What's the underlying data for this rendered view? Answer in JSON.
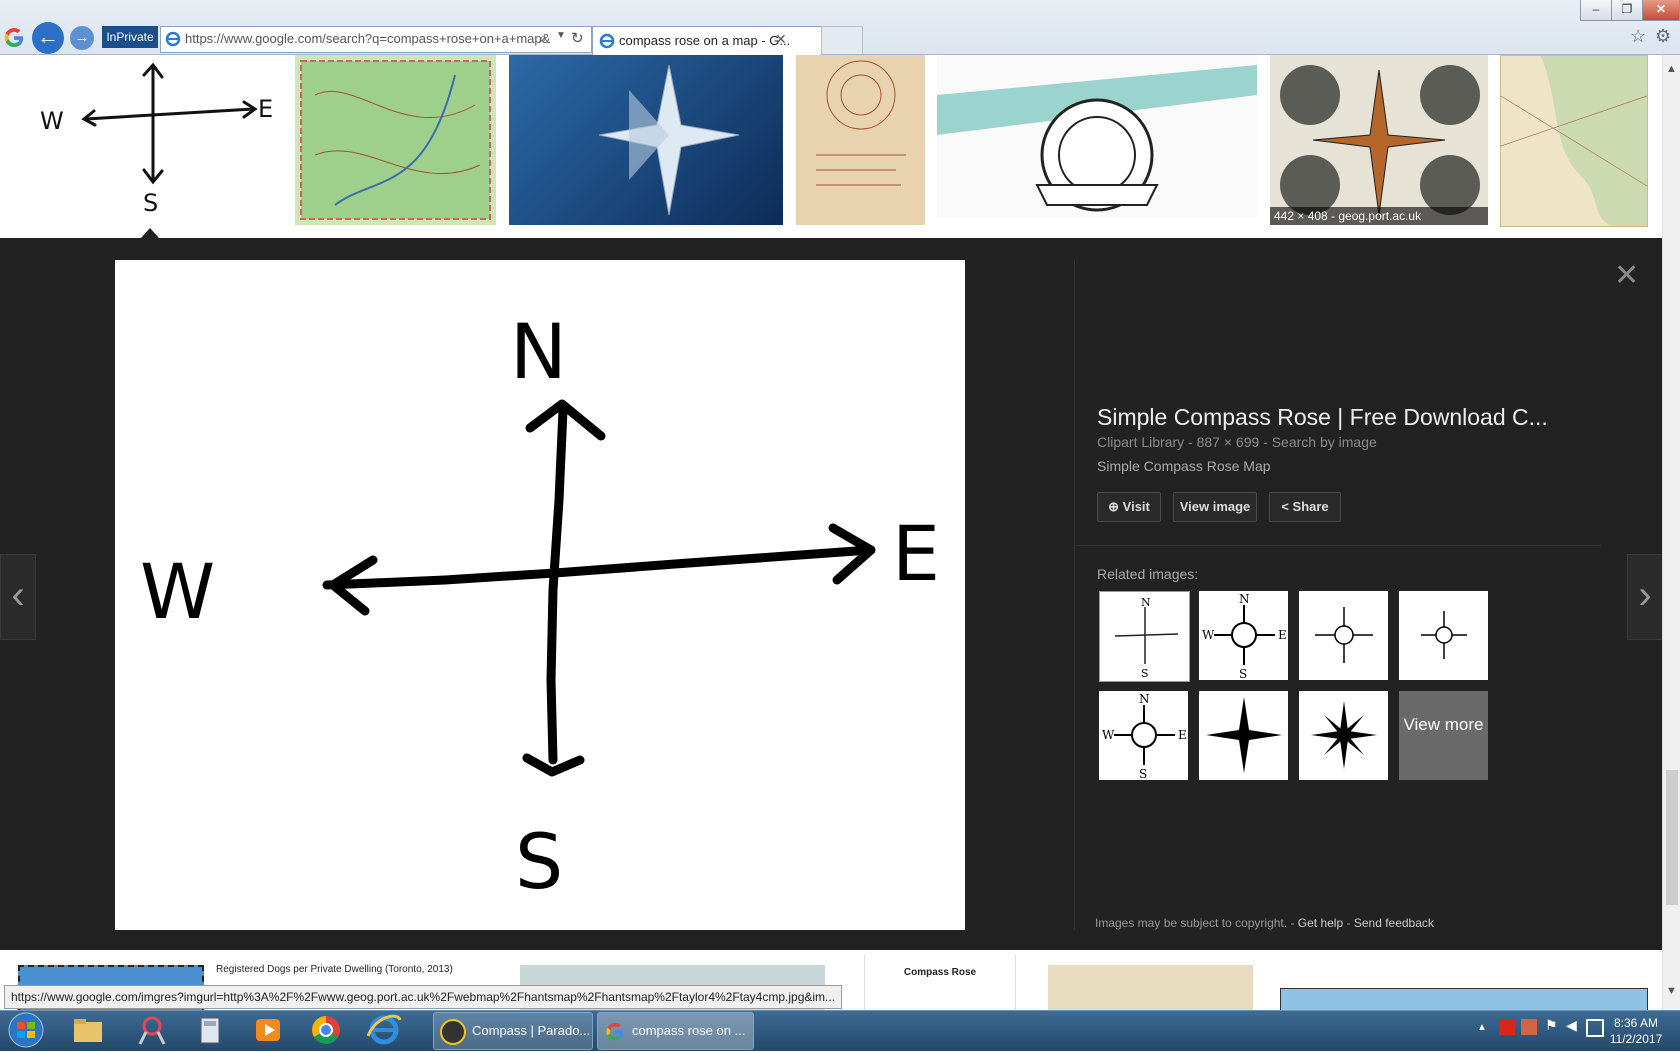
{
  "browser": {
    "mode_badge": "InPrivate",
    "address": "https://www.google.com/search?q=compass+rose+on+a+map&",
    "active_tab": "compass rose on a map - G...",
    "window_buttons": {
      "minimize": "–",
      "maximize": "❐",
      "close": "✕"
    }
  },
  "top_strip": {
    "thumb_caption": "442 × 408 - geog.port.ac.uk",
    "compass_letters": {
      "w": "W",
      "e": "E",
      "s": "S"
    }
  },
  "viewer": {
    "main_image_letters": {
      "n": "N",
      "w": "W",
      "e": "E",
      "s": "S"
    },
    "title": "Simple Compass Rose | Free Download C...",
    "meta": {
      "source": "Clipart Library",
      "sep1": "-",
      "dims": "887 × 699",
      "sep2": "-",
      "search": "Search by image"
    },
    "subtitle": "Simple Compass Rose Map",
    "buttons": {
      "visit": "Visit",
      "view_image": "View image",
      "share": "Share"
    },
    "related_label": "Related images:",
    "view_more": "View more",
    "footer": {
      "copyright": "Images may be subject to copyright.",
      "sep1": "-",
      "help": "Get help",
      "sep2": "-",
      "feedback": "Send feedback"
    }
  },
  "bottom_strip": {
    "dogs_title": "Registered Dogs per Private Dwelling (Toronto, 2013)",
    "compass_rose_title": "Compass Rose"
  },
  "status_url": "https://www.google.com/imgres?imgurl=http%3A%2F%2Fwww.geog.port.ac.uk%2Fwebmap%2Fhantsmap%2Fhantsmap%2Ftaylor4%2Ftay4cmp.jpg&im...",
  "taskbar": {
    "task1": "Compass | Parado...",
    "task2": "compass rose on ...",
    "time": "8:36 AM",
    "date": "11/2/2017"
  },
  "colors": {
    "viewer_bg": "#222222",
    "accent_blue": "#1a4f8a",
    "taskbar": "#2f5a80"
  }
}
